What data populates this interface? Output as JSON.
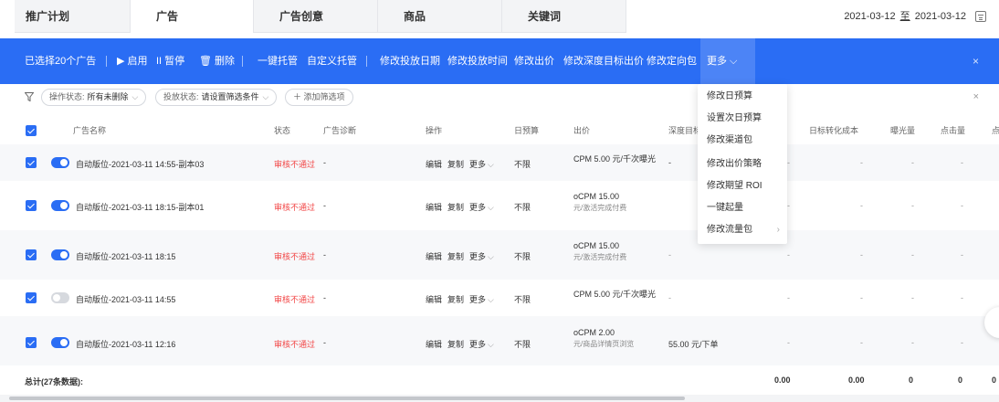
{
  "tabs": [
    "推广计划",
    "广告",
    "广告创意",
    "商品",
    "关键词"
  ],
  "date_range": {
    "start": "2021-03-12",
    "sep": "至",
    "end": "2021-03-12"
  },
  "action_bar": {
    "selected": "已选择20个广告",
    "enable": "▶ 启用",
    "pause": "II 暂停",
    "delete": "🗑 删除",
    "one_click": "一键托管",
    "custom": "自定义托管",
    "edit_date": "修改投放日期",
    "edit_time": "修改投放时间",
    "edit_bid": "修改出价",
    "edit_deep": "修改深度目标出价",
    "edit_pack": "修改定向包",
    "more": "更多 ⌵",
    "close": "×"
  },
  "filters": {
    "op_label": "操作状态:",
    "op_value": "所有未删除",
    "delivery_label": "投放状态:",
    "delivery_value": "请设置筛选条件",
    "add": "＋ 添加筛选项",
    "close": "×"
  },
  "columns": {
    "name": "广告名称",
    "status": "状态",
    "diag": "广告诊断",
    "op": "操作",
    "budget": "日预算",
    "bid": "出价",
    "deep": "深度目标",
    "target_cost": "日标转化成本",
    "impressions": "曝光量",
    "clicks": "点击量",
    "extra": "点"
  },
  "menu": [
    "修改日预算",
    "设置次日预算",
    "修改渠道包",
    "修改出价策略",
    "修改期望 ROI",
    "一键起量",
    "修改流量包"
  ],
  "rows": [
    {
      "name": "自动版位-2021-03-11 14:55-副本03",
      "status": "审核不通过",
      "diag": "-",
      "edit": "编辑",
      "copy": "复制",
      "more": "更多",
      "budget": "不限",
      "bid1": "CPM  5.00 元/千次曝光",
      "bid2": "",
      "deep": "-",
      "on": true
    },
    {
      "name": "自动版位-2021-03-11 18:15-副本01",
      "status": "审核不通过",
      "diag": "-",
      "edit": "编辑",
      "copy": "复制",
      "more": "更多",
      "budget": "不限",
      "bid1": "oCPM  15.00",
      "bid2": "元/激活完成付费",
      "deep": "",
      "on": true
    },
    {
      "name": "自动版位-2021-03-11 18:15",
      "status": "审核不通过",
      "diag": "-",
      "edit": "编辑",
      "copy": "复制",
      "more": "更多",
      "budget": "不限",
      "bid1": "oCPM  15.00",
      "bid2": "元/激活完成付费",
      "deep": "-",
      "on": true
    },
    {
      "name": "自动版位-2021-03-11 14:55",
      "status": "审核不通过",
      "diag": "-",
      "edit": "编辑",
      "copy": "复制",
      "more": "更多",
      "budget": "不限",
      "bid1": "CPM  5.00 元/千次曝光",
      "bid2": "",
      "deep": "-",
      "on": false
    },
    {
      "name": "自动版位-2021-03-11 12:16",
      "status": "审核不通过",
      "diag": "-",
      "edit": "编辑",
      "copy": "复制",
      "more": "更多",
      "budget": "不限",
      "bid1": "oCPM  2.00",
      "bid2": "元/商品详情页浏览",
      "deep": "55.00  元/下单",
      "on": true
    }
  ],
  "total": {
    "label": "总计(27条数据):",
    "v1": "0.00",
    "v2": "0.00",
    "v3": "0",
    "v4": "0",
    "v5": "0"
  },
  "colors": {
    "accent": "#2a6df4",
    "danger": "#f24747"
  }
}
